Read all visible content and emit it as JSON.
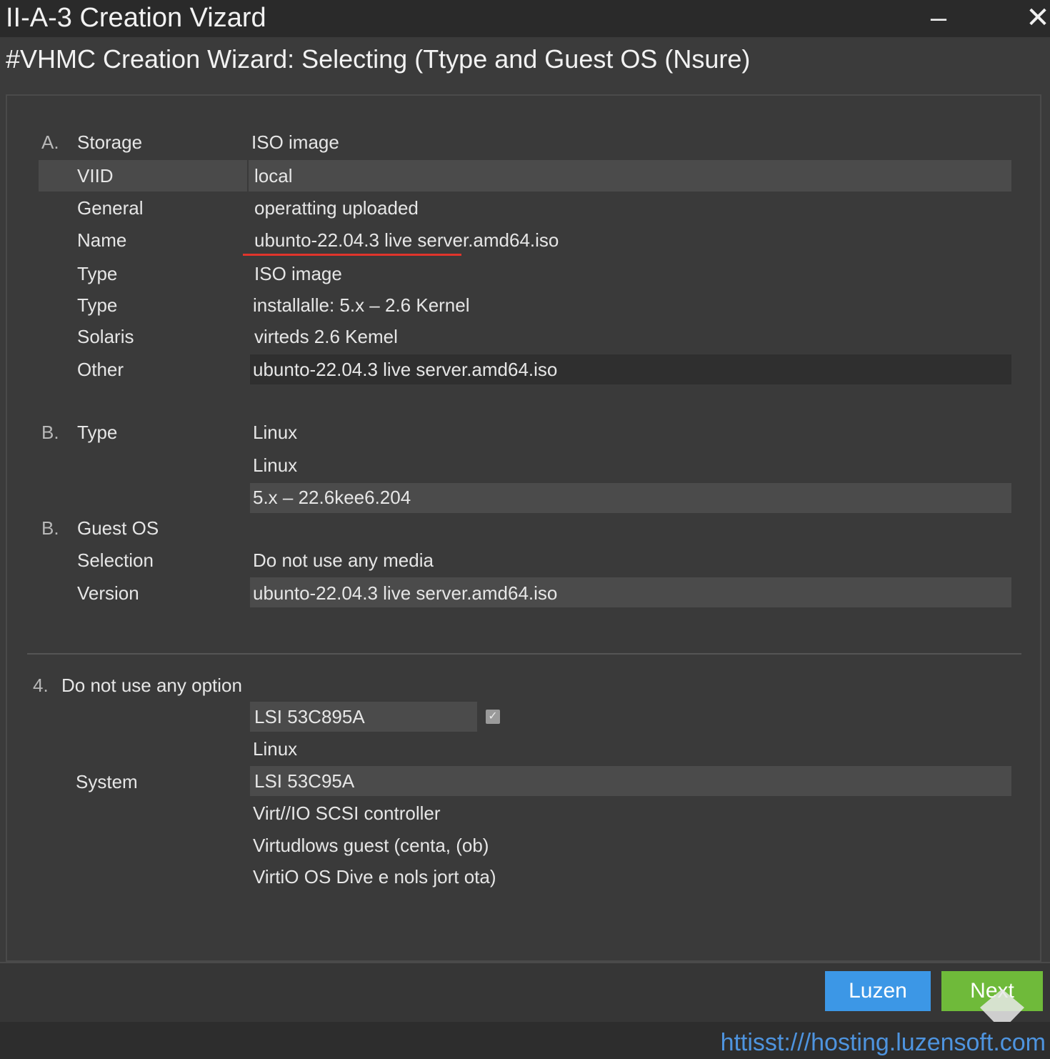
{
  "window": {
    "title": "II-A-3 Creation Vizard",
    "minimize_icon": "minimize-icon",
    "close_icon": "close-icon"
  },
  "subtitle": "#VHMC Creation Wizard: Selecting (Ttype and Guest OS (Nsure)",
  "section_a": {
    "letter": "A.",
    "rows": [
      {
        "label": "Storage",
        "value": "ISO image"
      },
      {
        "label": "VIID",
        "value": "local"
      },
      {
        "label": "General",
        "value": "operatting uploaded"
      },
      {
        "label": "Name",
        "value": "ubunto-22.04.3 live server.amd64.iso"
      },
      {
        "label": "Type",
        "value": "ISO image"
      },
      {
        "label": "Type",
        "value": "installalle: 5.x – 2.6 Kernel"
      },
      {
        "label": "Solaris",
        "value": "virteds 2.6 Kemel"
      },
      {
        "label": "Other",
        "value": "ubunto-22.04.3 live server.amd64.iso"
      }
    ]
  },
  "section_b_type": {
    "letter": "B.",
    "label": "Type",
    "values": [
      "Linux",
      "Linux",
      "5.x – 22.6kee6.204"
    ]
  },
  "section_b_guest": {
    "letter": "B.",
    "label": "Guest OS",
    "rows": [
      {
        "label": "Selection",
        "value": "Do not use any media"
      },
      {
        "label": "Version",
        "value": "ubunto-22.04.3 live server.amd64.iso"
      }
    ]
  },
  "section_4": {
    "number": "4.",
    "title": "Do not use any option",
    "controller_field": "LSI 53C895A",
    "checkbox_checked": true,
    "linux_value": "Linux",
    "system_label": "System",
    "system_field": "LSI 53C95A",
    "options": [
      "Virt//IO SCSI controller",
      "Virtudlows guest (centa, (ob)",
      "VirtiO OS Dive e nols jort ota)"
    ]
  },
  "buttons": {
    "luzen": "Luzen",
    "next": "Next"
  },
  "url": "httisst:///hosting.luzensoft.com",
  "colors": {
    "luzen_button": "#3c97e6",
    "next_button": "#6fba3a",
    "name_underline": "#e0342b",
    "url_text": "#4e94df"
  }
}
